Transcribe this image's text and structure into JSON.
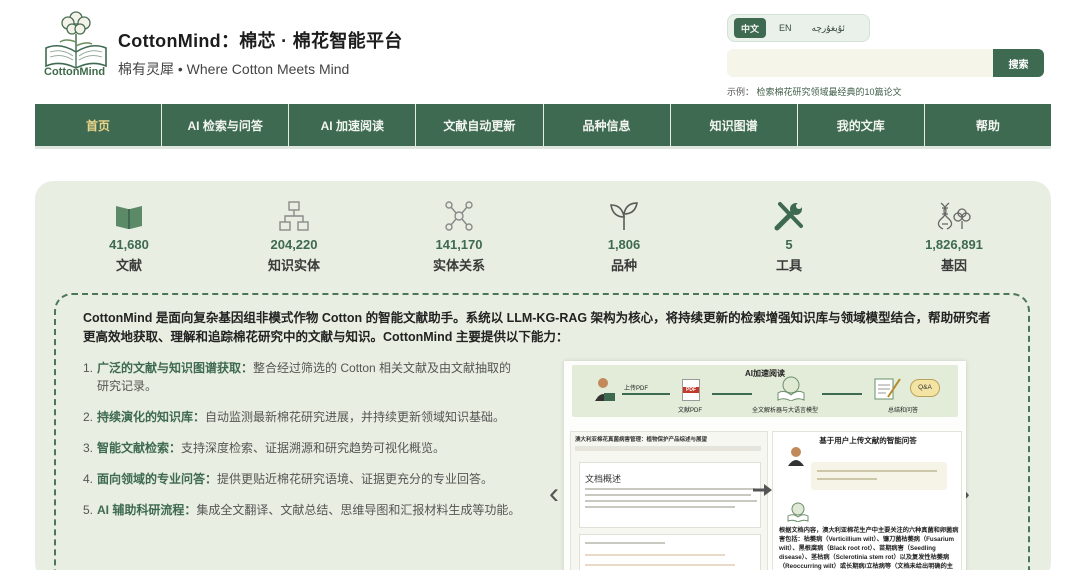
{
  "header": {
    "logo_text": "CottonMind",
    "title": "CottonMind：棉芯 · 棉花智能平台",
    "subtitle": "棉有灵犀 • Where Cotton Meets Mind"
  },
  "language": {
    "options": [
      "中文",
      "EN",
      "ئۇيغۇرچە"
    ],
    "selected": "中文"
  },
  "search": {
    "placeholder": "",
    "button_label": "搜索",
    "example_prefix": "示例：",
    "example_text": "检索棉花研究领域最经典的10篇论文"
  },
  "nav": {
    "items": [
      "首页",
      "AI 检索与问答",
      "AI 加速阅读",
      "文献自动更新",
      "品种信息",
      "知识图谱",
      "我的文库",
      "帮助"
    ],
    "active": "首页"
  },
  "stats": [
    {
      "icon": "book-icon",
      "number": "41,680",
      "label": "文献"
    },
    {
      "icon": "hierarchy-icon",
      "number": "204,220",
      "label": "知识实体"
    },
    {
      "icon": "network-icon",
      "number": "141,170",
      "label": "实体关系"
    },
    {
      "icon": "sprout-icon",
      "number": "1,806",
      "label": "品种"
    },
    {
      "icon": "tools-icon",
      "number": "5",
      "label": "工具"
    },
    {
      "icon": "dna-cotton-icon",
      "number": "1,826,891",
      "label": "基因"
    }
  ],
  "intro": "CottonMind 是面向复杂基因组非模式作物 Cotton 的智能文献助手。系统以 LLM-KG-RAG 架构为核心，将持续更新的检索增强知识库与领域模型结合，帮助研究者更高效地获取、理解和追踪棉花研究中的文献与知识。CottonMind 主要提供以下能力：",
  "features": [
    {
      "num": "1.",
      "title": "广泛的文献与知识图谱获取：",
      "text": "整合经过筛选的 Cotton 相关文献及由文献抽取的研究记录。"
    },
    {
      "num": "2.",
      "title": "持续演化的知识库：",
      "text": "自动监测最新棉花研究进展，并持续更新领域知识基础。"
    },
    {
      "num": "3.",
      "title": "智能文献检索：",
      "text": "支持深度检索、证据溯源和研究趋势可视化概览。"
    },
    {
      "num": "4.",
      "title": "面向领域的专业问答：",
      "text": "提供更贴近棉花研究语境、证据更充分的专业回答。"
    },
    {
      "num": "5.",
      "title": "AI 辅助科研流程：",
      "text": "集成全文翻译、文献总结、思维导图和汇报材料生成等功能。"
    }
  ],
  "carousel": {
    "prev": "‹",
    "next": "›",
    "flow_title": "AI加速阅读",
    "step_upload": "上传PDF",
    "step_pdf": "PDF",
    "step_pdf_label": "文献PDF",
    "step_parse": "全文解析器与大语言模型",
    "step_qa": "Q&A",
    "step_output": "总结和问答",
    "left_title": "澳大利亚棉花真菌病害管理：植物保护产品综述与展望",
    "doc_heading": "文档概述",
    "right_title": "基于用户上传文献的智能问答",
    "answer": "根据文档内容，澳大利亚棉花生产中主要关注的六种真菌和卵菌病害包括：枯萎病（Verticillium wilt）、镰刀菌枯萎病（Fusarium wilt）、黑根腐病（Black root rot）、苗期病害（Seedling disease）、茎枯病（Sclerotinia stem rot）以及复发性枯萎病（Reoccurring wilt）或长期病/立枯病等（文档未给出明确的主要病害名称）。但核心主要病害是"
  }
}
